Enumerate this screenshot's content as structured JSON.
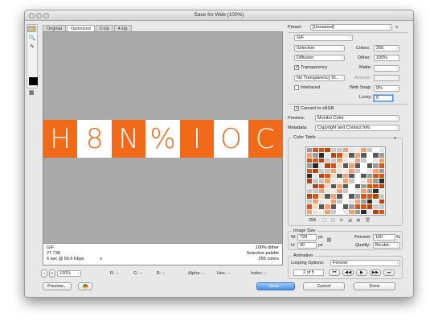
{
  "window": {
    "title": "Save for Web (100%)"
  },
  "tabs": [
    "Original",
    "Optimized",
    "2-Up",
    "4-Up"
  ],
  "glyphs": [
    "H",
    "8",
    "N",
    "%",
    "I",
    "O",
    "C"
  ],
  "info": {
    "left": [
      "GIF",
      "27.73K",
      "6 sec @ 56.6 Kbps"
    ],
    "right": [
      "100% dither",
      "Selective palette",
      "256 colors"
    ],
    "menu_icon": "≡"
  },
  "status": {
    "zoom": "100%",
    "r": "R: --",
    "g": "G: --",
    "b": "B: --",
    "alpha": "Alpha: --",
    "hex": "Hex: --",
    "index": "Index: --"
  },
  "bottom": {
    "preview": "Preview...",
    "save": "Save...",
    "cancel": "Cancel",
    "done": "Done"
  },
  "right": {
    "preset_label": "Preset:",
    "preset_value": "[Unnamed]",
    "format": "GIF",
    "reduction": "Selective",
    "dither_algo": "Diffusion",
    "colors_label": "Colors:",
    "colors_value": "256",
    "dither_label": "Dither:",
    "dither_value": "100%",
    "transparency": "Transparency",
    "matte_label": "Matte:",
    "no_transparency": "No Transparency Di...",
    "amount_label": "Amount:",
    "interlaced": "Interlaced",
    "websnap_label": "Web Snap:",
    "websnap_value": "0%",
    "lossy_label": "Lossy:",
    "lossy_value": "0",
    "convert_srgb": "Convert to sRGB",
    "preview_label": "Preview:",
    "preview_value": "Monitor Color",
    "metadata_label": "Metadata:",
    "metadata_value": "Copyright and Contact Info",
    "color_table_label": "Color Table",
    "color_count": "256",
    "image_size_label": "Image Size",
    "w_label": "W:",
    "w_value": "728",
    "h_label": "H:",
    "h_value": "90",
    "px": "px",
    "percent_label": "Percent:",
    "percent_value": "100",
    "percent_unit": "%",
    "quality_label": "Quality:",
    "quality_value": "Bicubic",
    "animation_label": "Animation",
    "looping_label": "Looping Options:",
    "looping_value": "Forever",
    "frame_counter": "2 of 5"
  },
  "colors": {
    "accent": "#f06a1a",
    "canvas": "#a9a9a9",
    "save_button": "#4a90e2"
  }
}
